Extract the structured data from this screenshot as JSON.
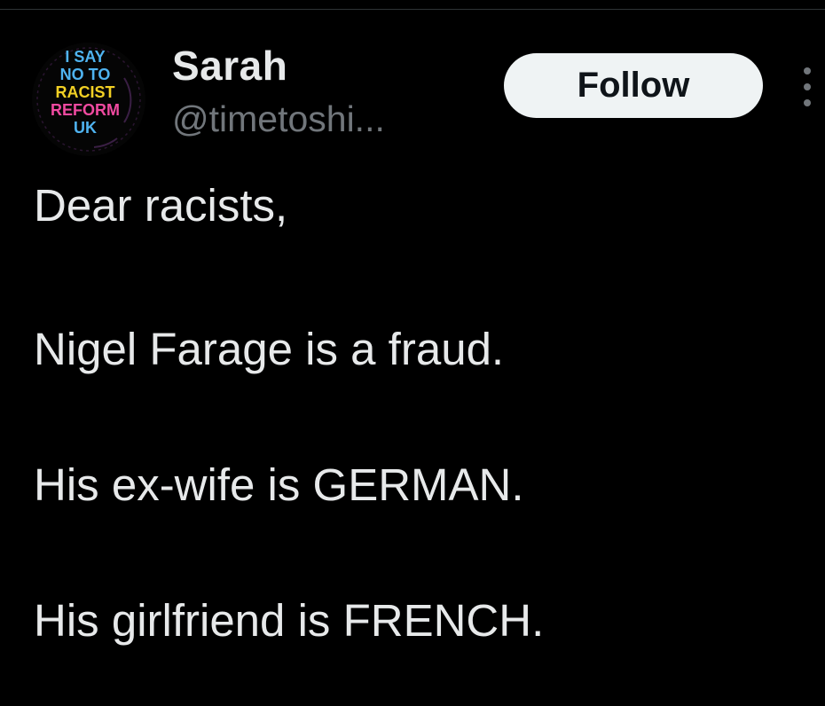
{
  "author": {
    "display_name": "Sarah",
    "handle": "@timetoshi...",
    "avatar": {
      "text_lines": [
        "I SAY",
        "NO TO",
        "RACIST",
        "REFORM",
        "UK"
      ],
      "line_colors": [
        "#4fb3f0",
        "#4fb3f0",
        "#f2d024",
        "#f04aa0",
        "#4fb3f0"
      ],
      "background": "#050505"
    }
  },
  "actions": {
    "follow_label": "Follow",
    "more_icon": "more-dots-vertical-icon"
  },
  "tweet": {
    "lines": [
      "Dear racists,",
      "Nigel Farage is a fraud.",
      "His ex-wife is GERMAN.",
      "His girlfriend is FRENCH."
    ]
  },
  "colors": {
    "background": "#000000",
    "primary_text": "#e7e9ea",
    "secondary_text": "#71767b",
    "follow_button_bg": "#eff3f4",
    "follow_button_text": "#0f1419"
  }
}
